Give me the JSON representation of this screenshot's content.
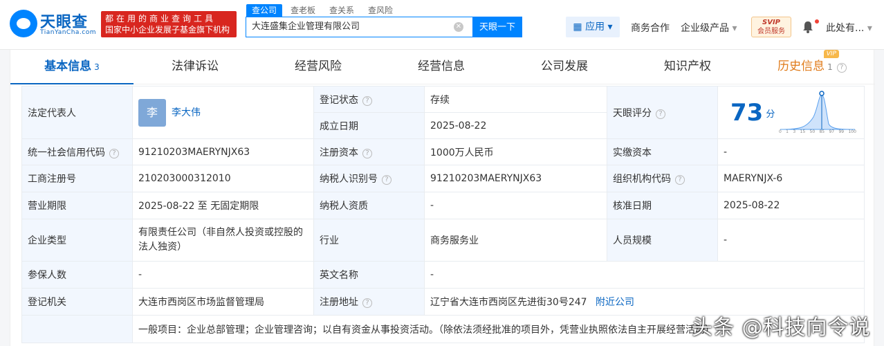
{
  "logo": {
    "text": "天眼查",
    "sub": "TianYanCha.com"
  },
  "promo": {
    "line1": "都在用的商业查询工具",
    "line2": "国家中小企业发展子基金旗下机构"
  },
  "search": {
    "tabs": [
      "查公司",
      "查老板",
      "查关系",
      "查风险"
    ],
    "value": "大连盛集企业管理有限公司",
    "button": "天眼一下"
  },
  "nav": {
    "apps": "应用",
    "business": "商务合作",
    "enterprise": "企业级产品",
    "svip_top": "SVIP",
    "svip_bottom": "会员服务",
    "user": "此处有..."
  },
  "tabs": [
    {
      "label": "基本信息",
      "count": "3"
    },
    {
      "label": "法律诉讼"
    },
    {
      "label": "经营风险"
    },
    {
      "label": "经营信息"
    },
    {
      "label": "公司发展"
    },
    {
      "label": "知识产权"
    },
    {
      "label": "历史信息",
      "count": "1",
      "badge": "VIP"
    }
  ],
  "info": {
    "legal_rep_label": "法定代表人",
    "legal_rep_avatar": "李",
    "legal_rep_name": "李大伟",
    "reg_status_label": "登记状态",
    "reg_status": "存续",
    "found_date_label": "成立日期",
    "found_date": "2025-08-22",
    "score_label": "天眼评分",
    "score": "73",
    "score_unit": "分",
    "score_ticks": [
      "0",
      "1",
      "3",
      "15",
      "50",
      "85",
      "97",
      "99",
      "100"
    ],
    "credit_code_label": "统一社会信用代码",
    "credit_code": "91210203MAERYNJX63",
    "reg_capital_label": "注册资本",
    "reg_capital": "1000万人民币",
    "paid_capital_label": "实缴资本",
    "paid_capital": "-",
    "biz_reg_no_label": "工商注册号",
    "biz_reg_no": "210203000312010",
    "taxpayer_id_label": "纳税人识别号",
    "taxpayer_id": "91210203MAERYNJX63",
    "org_code_label": "组织机构代码",
    "org_code": "MAERYNJX-6",
    "biz_term_label": "营业期限",
    "biz_term": "2025-08-22 至 无固定期限",
    "taxpayer_qual_label": "纳税人资质",
    "taxpayer_qual": "-",
    "approve_date_label": "核准日期",
    "approve_date": "2025-08-22",
    "company_type_label": "企业类型",
    "company_type": "有限责任公司（非自然人投资或控股的法人独资）",
    "industry_label": "行业",
    "industry": "商务服务业",
    "staff_size_label": "人员规模",
    "staff_size": "-",
    "insured_label": "参保人数",
    "insured": "-",
    "en_name_label": "英文名称",
    "en_name": "-",
    "reg_authority_label": "登记机关",
    "reg_authority": "大连市西岗区市场监督管理局",
    "reg_address_label": "注册地址",
    "reg_address": "辽宁省大连市西岗区先进街30号247",
    "nearby": "附近公司",
    "scope": "一般项目：企业总部管理；企业管理咨询；以自有资金从事投资活动。（除依法须经批准的项目外，凭营业执照依法自主开展经营活动）"
  },
  "watermark": "头条 @科技向令说"
}
